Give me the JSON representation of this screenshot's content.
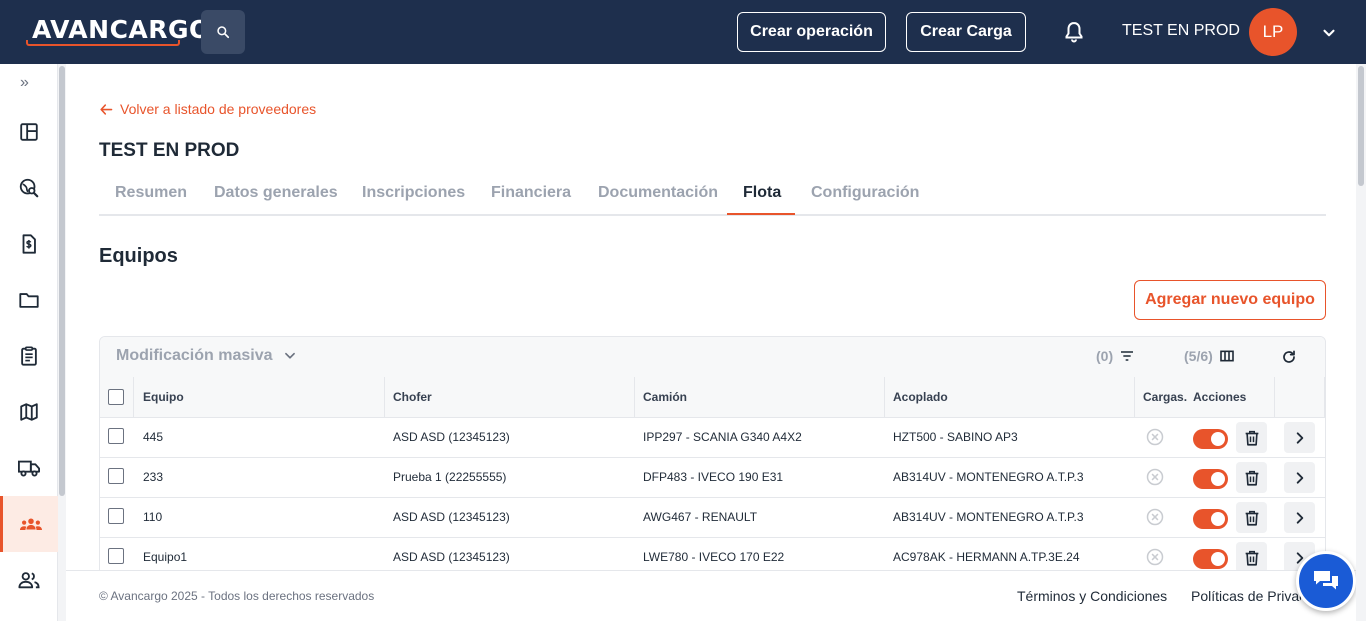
{
  "header": {
    "logo_text": "AVANCARGO",
    "create_operation_label": "Crear operación",
    "create_load_label": "Crear Carga",
    "user_name": "TEST EN PROD",
    "avatar_initials": "LP"
  },
  "sidebar": {
    "expand_label": "»",
    "items": [
      {
        "icon": "dashboard-icon"
      },
      {
        "icon": "search-globe-icon"
      },
      {
        "icon": "invoice-icon"
      },
      {
        "icon": "folder-icon"
      },
      {
        "icon": "clipboard-icon"
      },
      {
        "icon": "map-icon"
      },
      {
        "icon": "truck-icon"
      },
      {
        "icon": "providers-icon",
        "active": true
      },
      {
        "icon": "users-icon"
      }
    ]
  },
  "page": {
    "back_link": "Volver a listado de proveedores",
    "title": "TEST EN PROD",
    "tabs": [
      "Resumen",
      "Datos generales",
      "Inscripciones",
      "Financiera",
      "Documentación",
      "Flota",
      "Configuración"
    ],
    "active_tab": "Flota",
    "section_title": "Equipos",
    "add_button": "Agregar nuevo equipo"
  },
  "table": {
    "mass_edit_label": "Modificación masiva",
    "filter_count": "(0)",
    "column_count": "(5/6)",
    "columns": [
      "Equipo",
      "Chofer",
      "Camión",
      "Acoplado",
      "Cargas.",
      "Acciones"
    ],
    "rows": [
      {
        "equipo": "445",
        "chofer": "ASD ASD (12345123)",
        "camion": "IPP297 - SCANIA G340 A4X2",
        "acoplado": "HZT500 - SABINO AP3",
        "active": true
      },
      {
        "equipo": "233",
        "chofer": "Prueba 1 (22255555)",
        "camion": "DFP483 - IVECO 190 E31",
        "acoplado": "AB314UV - MONTENEGRO A.T.P.3",
        "active": true
      },
      {
        "equipo": "110",
        "chofer": "ASD ASD (12345123)",
        "camion": "AWG467 - RENAULT",
        "acoplado": "AB314UV - MONTENEGRO A.T.P.3",
        "active": true
      },
      {
        "equipo": "Equipo1",
        "chofer": "ASD ASD (12345123)",
        "camion": "LWE780 - IVECO 170 E22",
        "acoplado": "AC978AK - HERMANN A.TP.3E.24",
        "active": true
      }
    ]
  },
  "footer": {
    "copyright": "© Avancargo 2025 - Todos los derechos reservados",
    "terms": "Términos y Condiciones",
    "privacy": "Políticas de Privacidad"
  },
  "colors": {
    "brand_navy": "#1e2f4d",
    "accent_orange": "#e8542b",
    "chat_blue": "#1a5bd6"
  }
}
